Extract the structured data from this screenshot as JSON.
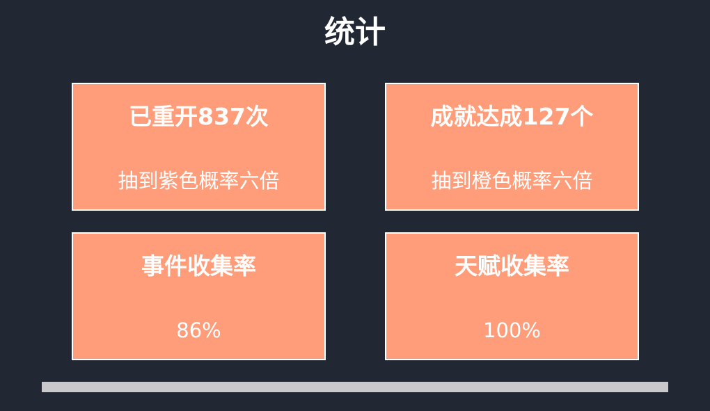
{
  "title": "统计",
  "cards": [
    {
      "title": "已重开837次",
      "value": "抽到紫色概率六倍"
    },
    {
      "title": "成就达成127个",
      "value": "抽到橙色概率六倍"
    },
    {
      "title": "事件收集率",
      "value": "86%"
    },
    {
      "title": "天赋收集率",
      "value": "100%"
    }
  ],
  "colors": {
    "background": "#212733",
    "card": "#ff9d7a",
    "card_border": "#ffffff",
    "scrollbar": "#c9c9cb"
  }
}
